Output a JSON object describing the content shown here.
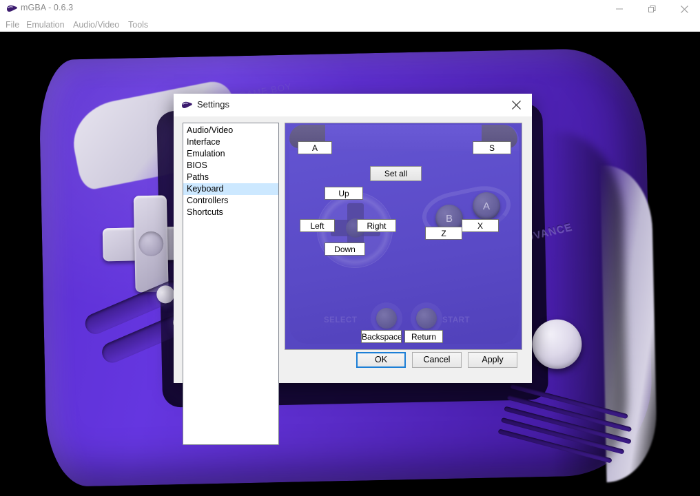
{
  "window": {
    "title": "mGBA - 0.6.3",
    "icon": "mgba-logo-icon",
    "controls": {
      "minimize": "minimize-icon",
      "maximize": "restore-icon",
      "close": "close-icon"
    },
    "menu": [
      {
        "label": "File"
      },
      {
        "label": "Emulation"
      },
      {
        "label": "Audio/Video"
      },
      {
        "label": "Tools"
      }
    ]
  },
  "background": {
    "scene": "3d-rendered-purple-game-boy-advance",
    "emboss_right": "ADVANCE",
    "emboss_topleft": "GAME BOY"
  },
  "dialog": {
    "title": "Settings",
    "icon": "mgba-logo-icon",
    "close": "close-icon",
    "sidebar": {
      "items": [
        {
          "label": "Audio/Video",
          "selected": false
        },
        {
          "label": "Interface",
          "selected": false
        },
        {
          "label": "Emulation",
          "selected": false
        },
        {
          "label": "BIOS",
          "selected": false
        },
        {
          "label": "Paths",
          "selected": false
        },
        {
          "label": "Keyboard",
          "selected": true
        },
        {
          "label": "Controllers",
          "selected": false
        },
        {
          "label": "Shortcuts",
          "selected": false
        }
      ],
      "selected_index": 5
    },
    "pad": {
      "set_all_label": "Set all",
      "select_label": "SELECT",
      "start_label": "START",
      "button_b_glyph": "B",
      "button_a_glyph": "A",
      "bindings": {
        "l_shoulder": "A",
        "r_shoulder": "S",
        "up": "Up",
        "down": "Down",
        "left": "Left",
        "right": "Right",
        "b": "Z",
        "a": "X",
        "select": "Backspace",
        "start": "Return"
      }
    },
    "buttons": {
      "ok": "OK",
      "cancel": "Cancel",
      "apply": "Apply"
    }
  },
  "colors": {
    "accent_blue": "#1c7fd6",
    "selection_blue": "#cce8ff",
    "pad_purple": "#5b4bc4",
    "dialog_bg": "#f0f0f0",
    "title_bg": "#ffffff",
    "gba_purple": "#5b2fd1"
  }
}
